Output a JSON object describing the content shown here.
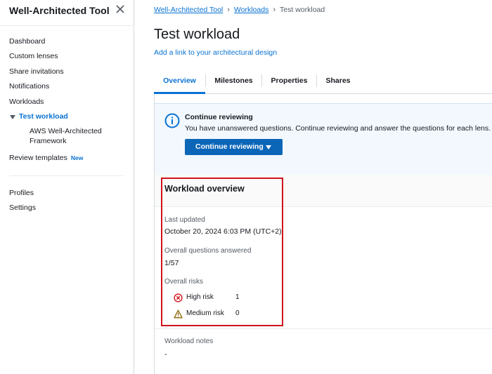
{
  "sidebar": {
    "title": "Well-Architected Tool",
    "items": [
      {
        "label": "Dashboard"
      },
      {
        "label": "Custom lenses"
      },
      {
        "label": "Share invitations"
      },
      {
        "label": "Notifications"
      },
      {
        "label": "Workloads"
      }
    ],
    "active_workload": "Test workload",
    "sub_item": "AWS Well-Architected Framework",
    "review_templates": "Review templates",
    "new_badge": "New",
    "bottom_items": [
      {
        "label": "Profiles"
      },
      {
        "label": "Settings"
      }
    ]
  },
  "breadcrumb": {
    "root": "Well-Architected Tool",
    "parent": "Workloads",
    "current": "Test workload"
  },
  "page": {
    "title": "Test workload",
    "arch_link": "Add a link to your architectural design"
  },
  "tabs": [
    {
      "label": "Overview"
    },
    {
      "label": "Milestones"
    },
    {
      "label": "Properties"
    },
    {
      "label": "Shares"
    }
  ],
  "alert": {
    "title": "Continue reviewing",
    "text": "You have unanswered questions. Continue reviewing and answer the questions for each lens.",
    "button": "Continue reviewing"
  },
  "overview": {
    "title": "Workload overview",
    "last_updated_label": "Last updated",
    "last_updated_value": "October 20, 2024 6:03 PM (UTC+2)",
    "questions_label": "Overall questions answered",
    "questions_value": "1/57",
    "risks_label": "Overall risks",
    "high_risk_label": "High risk",
    "high_risk_count": "1",
    "medium_risk_label": "Medium risk",
    "medium_risk_count": "0"
  },
  "notes": {
    "label": "Workload notes",
    "value": "-"
  },
  "colors": {
    "accent": "#0972d3",
    "button": "#0c66b8",
    "high_risk": "#d0121e",
    "medium_risk": "#8d6605",
    "highlight_box": "#d0121e"
  },
  "icons": {
    "close": "close-icon",
    "info": "info-icon",
    "high_risk": "x-circle-icon",
    "medium_risk": "warning-triangle-icon",
    "caret": "caret-down-icon"
  }
}
